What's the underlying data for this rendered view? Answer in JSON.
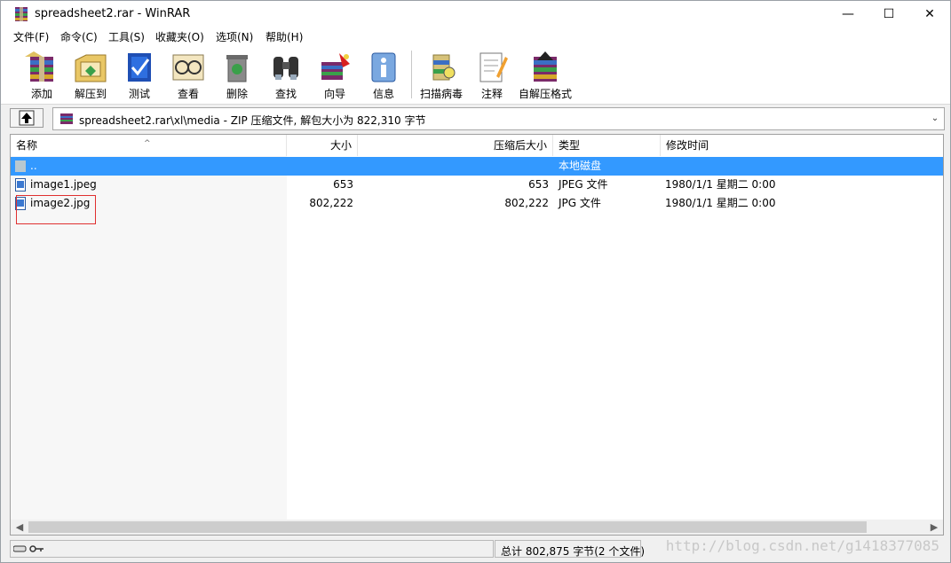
{
  "window": {
    "title": "spreadsheet2.rar - WinRAR",
    "controls": {
      "minimize": "—",
      "maximize": "☐",
      "close": "✕"
    }
  },
  "menu": [
    "文件(F)",
    "命令(C)",
    "工具(S)",
    "收藏夹(O)",
    "选项(N)",
    "帮助(H)"
  ],
  "toolbar": [
    {
      "label": "添加",
      "icon": "add-icon"
    },
    {
      "label": "解压到",
      "icon": "extract-to-icon"
    },
    {
      "label": "测试",
      "icon": "test-icon"
    },
    {
      "label": "查看",
      "icon": "view-icon"
    },
    {
      "label": "删除",
      "icon": "delete-icon"
    },
    {
      "label": "查找",
      "icon": "find-icon"
    },
    {
      "label": "向导",
      "icon": "wizard-icon"
    },
    {
      "label": "信息",
      "icon": "info-icon"
    },
    {
      "label": "扫描病毒",
      "icon": "virus-scan-icon"
    },
    {
      "label": "注释",
      "icon": "comment-icon"
    },
    {
      "label": "自解压格式",
      "icon": "sfx-icon"
    }
  ],
  "address": {
    "text": "spreadsheet2.rar\\xl\\media - ZIP 压缩文件, 解包大小为 822,310 字节"
  },
  "columns": {
    "name": "名称",
    "size": "大小",
    "packed": "压缩后大小",
    "type": "类型",
    "modified": "修改时间",
    "sort_indicator": "^"
  },
  "rows": [
    {
      "name": "..",
      "size": "",
      "packed": "",
      "type": "本地磁盘",
      "modified": "",
      "selected": true
    },
    {
      "name": "image1.jpeg",
      "size": "653",
      "packed": "653",
      "type": "JPEG 文件",
      "modified": "1980/1/1 星期二 0:00",
      "selected": false
    },
    {
      "name": "image2.jpg",
      "size": "802,222",
      "packed": "802,222",
      "type": "JPG 文件",
      "modified": "1980/1/1 星期二 0:00",
      "selected": false
    }
  ],
  "status": {
    "total": "总计 802,875 字节(2 个文件)",
    "watermark": "http://blog.csdn.net/g1418377085"
  },
  "colors": {
    "selection": "#3399ff",
    "highlight_box": "#e03030"
  }
}
